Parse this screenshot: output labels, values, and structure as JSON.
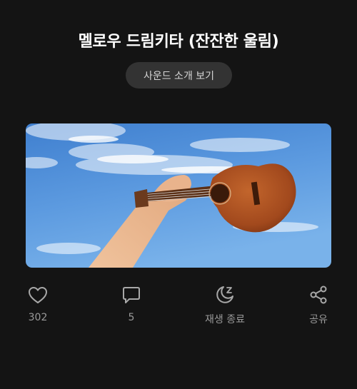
{
  "header": {
    "title": "멜로우 드림키타 (잔잔한 울림)"
  },
  "sound_button": {
    "label": "사운드 소개 보기"
  },
  "artwork": {
    "description_icon": "ukulele-sky-photo"
  },
  "actions": [
    {
      "icon": "heart-icon",
      "label": "302"
    },
    {
      "icon": "comment-icon",
      "label": "5"
    },
    {
      "icon": "sleep-timer-icon",
      "label": "재생 종료"
    },
    {
      "icon": "share-icon",
      "label": "공유"
    }
  ],
  "colors": {
    "background": "#141414",
    "button_bg": "#333333",
    "icon": "#a8a8a8",
    "label": "#9a9a9a"
  }
}
